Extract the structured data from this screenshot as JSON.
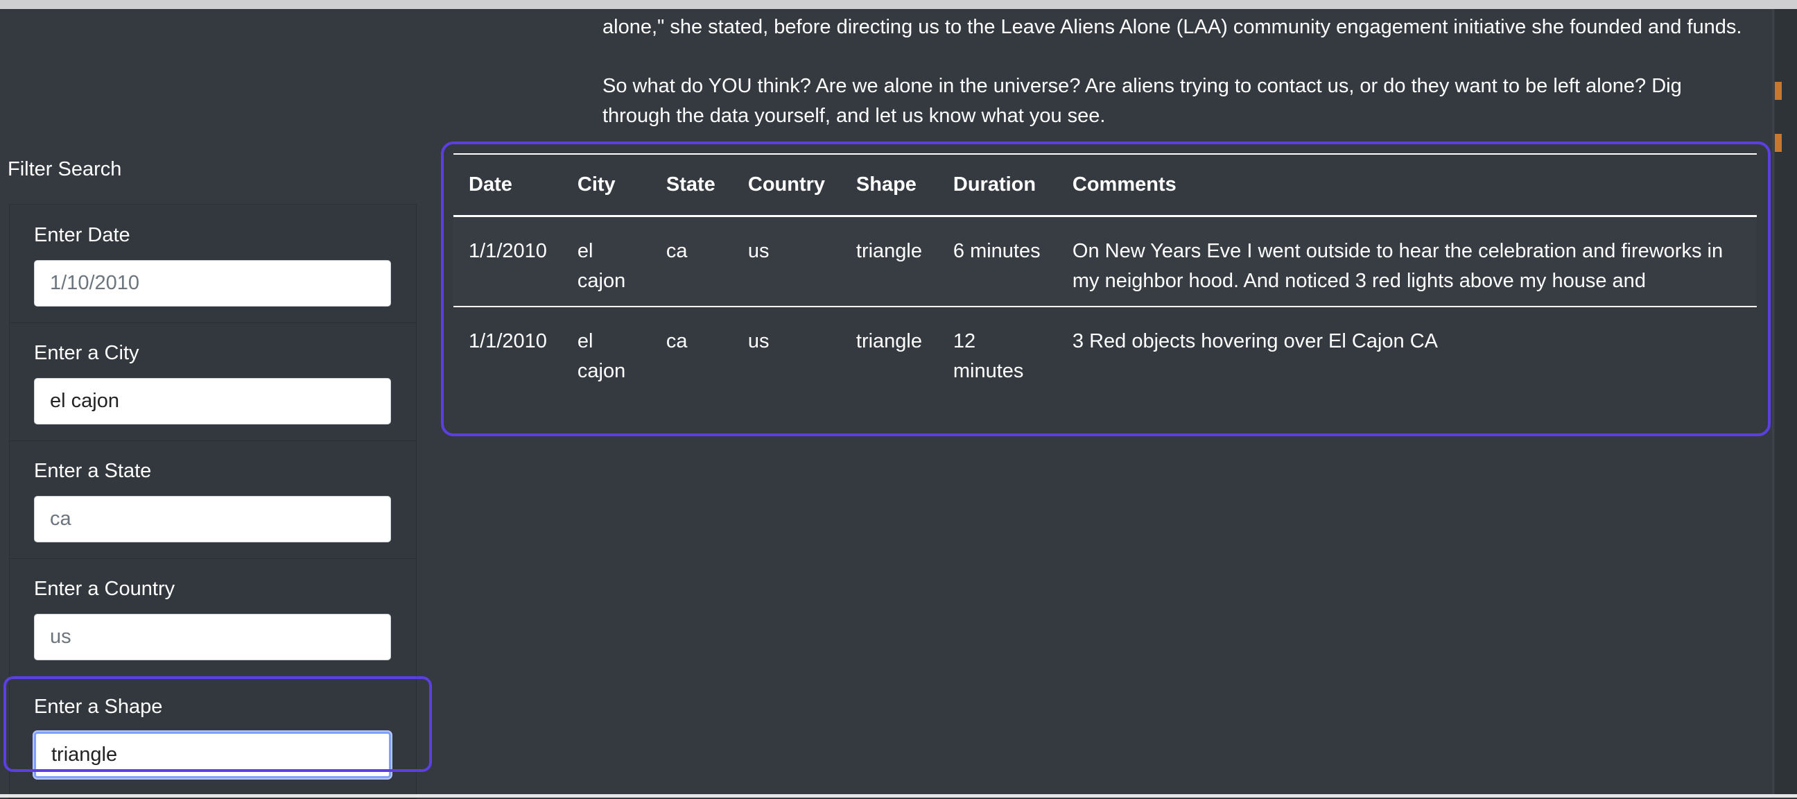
{
  "intro": {
    "line1": "alone,\" she stated, before directing us to the Leave Aliens Alone (LAA) community engagement initiative she founded and funds.",
    "line2": "So what do YOU think? Are we alone in the universe? Are aliens trying to contact us, or do they want to be left alone? Dig",
    "line3": "through the data yourself, and let us know what you see."
  },
  "filter": {
    "heading": "Filter Search",
    "items": [
      {
        "label": "Enter Date",
        "value": "",
        "placeholder": "1/10/2010"
      },
      {
        "label": "Enter a City",
        "value": "el cajon",
        "placeholder": ""
      },
      {
        "label": "Enter a State",
        "value": "",
        "placeholder": "ca"
      },
      {
        "label": "Enter a Country",
        "value": "",
        "placeholder": "us"
      },
      {
        "label": "Enter a Shape",
        "value": "triangle",
        "placeholder": ""
      }
    ]
  },
  "table": {
    "headers": [
      "Date",
      "City",
      "State",
      "Country",
      "Shape",
      "Duration",
      "Comments"
    ],
    "rows": [
      {
        "date": "1/1/2010",
        "city": "el cajon",
        "state": "ca",
        "country": "us",
        "shape": "triangle",
        "duration": "6 minutes",
        "comments": "On New Years Eve I went outside to hear the celebration and fireworks in my neighbor hood. And noticed 3 red lights above my house and"
      },
      {
        "date": "1/1/2010",
        "city": "el cajon",
        "state": "ca",
        "country": "us",
        "shape": "triangle",
        "duration": "12 minutes",
        "comments": "3 Red objects hovering over El Cajon CA"
      }
    ]
  },
  "colors": {
    "background": "#343a40",
    "highlight": "#5b3fe0",
    "accent_marks": "#c8772f"
  }
}
